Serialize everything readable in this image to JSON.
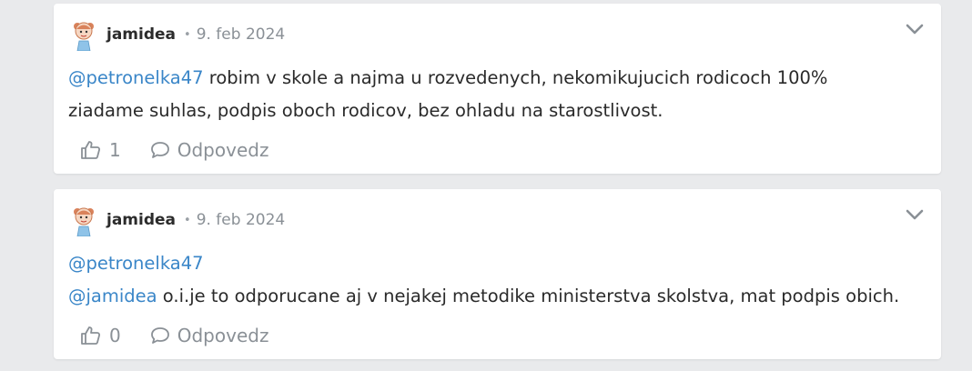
{
  "comments": [
    {
      "author": "jamidea",
      "separator": "•",
      "date": "9. feb 2024",
      "mention": "@petronelka47",
      "text_line1": " robim v skole a najma u rozvedenych, nekomikujucich rodicoch 100%",
      "text_line2": "ziadame suhlas, podpis oboch rodicov, bez ohladu na starostlivost.",
      "likes": "1",
      "reply_label": "Odpovedz"
    },
    {
      "author": "jamidea",
      "separator": "•",
      "date": "9. feb 2024",
      "mention_line1": "@petronelka47",
      "mention_line2": "@jamidea",
      "text_line2": " o.i.je to odporucane aj v nejakej metodike ministerstva skolstva, mat podpis obich.",
      "likes": "0",
      "reply_label": "Odpovedz"
    }
  ],
  "icons": {
    "avatar": "girl-avatar-icon",
    "menu": "chevron-down-icon",
    "like": "thumbs-up-icon",
    "reply": "speech-bubble-icon"
  },
  "colors": {
    "mention": "#3a86c8",
    "muted": "#8a9096",
    "background": "#e9eaec"
  }
}
